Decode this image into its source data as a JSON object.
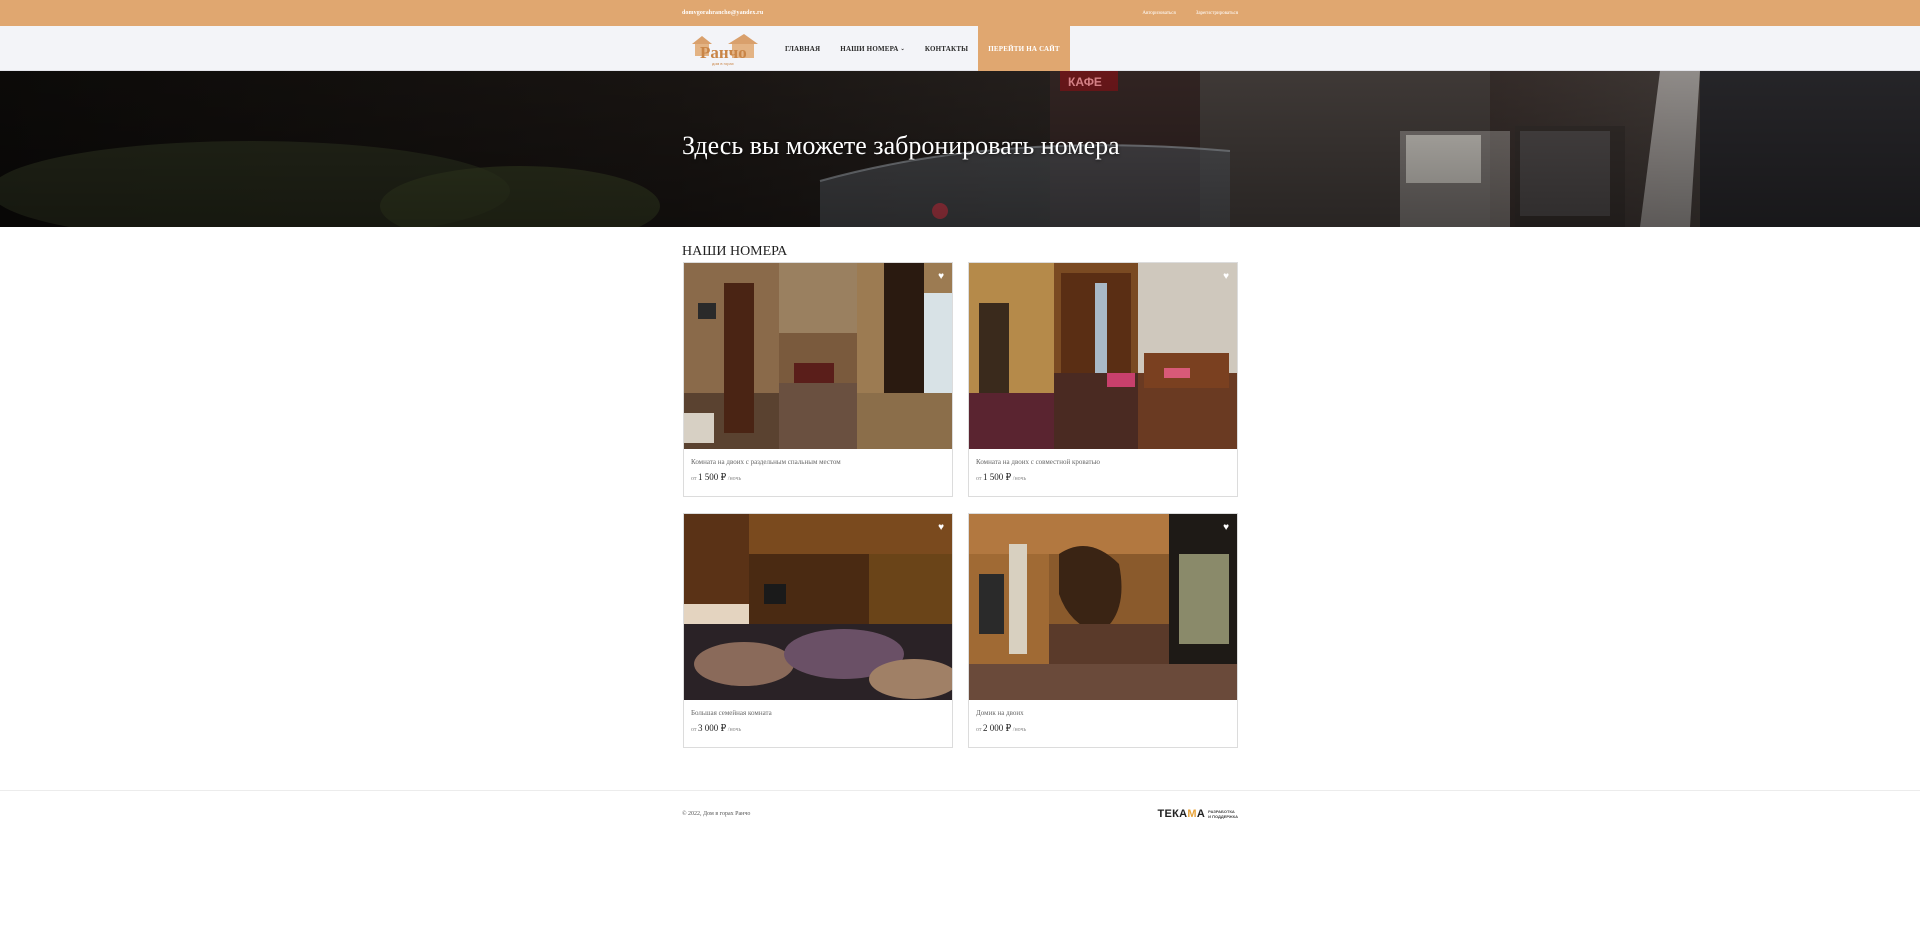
{
  "topbar": {
    "email": "domvgorahrancho@yandex.ru",
    "login": "Авторизоваться",
    "register": "Зарегистрироваться"
  },
  "nav": {
    "logo_text": "Ранчо",
    "logo_sub": "дом в горах",
    "items": [
      {
        "label": "ГЛАВНАЯ"
      },
      {
        "label": "НАШИ НОМЕРА",
        "dropdown": true
      },
      {
        "label": "КОНТАКТЫ"
      }
    ],
    "cta": "ПЕРЕЙТИ НА САЙТ"
  },
  "hero": {
    "title": "Здесь вы можете забронировать номера"
  },
  "rooms": {
    "heading": "НАШИ НОМЕРА",
    "items": [
      {
        "title": "Комната на двоих с раздельным спальным местом",
        "from": "от",
        "price": "1 500 ₽",
        "unit": "/ночь"
      },
      {
        "title": "Комната на двоих с совместной кроватью",
        "from": "от",
        "price": "1 500 ₽",
        "unit": "/ночь"
      },
      {
        "title": "Большая семейная комната",
        "from": "от",
        "price": "3 000 ₽",
        "unit": "/ночь"
      },
      {
        "title": "Домик на двоих",
        "from": "от",
        "price": "2 000 ₽",
        "unit": "/ночь"
      }
    ]
  },
  "footer": {
    "copyright": "© 2022,  Дом в горах Ранчо",
    "brand_main": "ТЕКА",
    "brand_accent": "М",
    "brand_end": "А",
    "brand_tag_line1": "РАЗРАБОТКА",
    "brand_tag_line2": "И ПОДДЕРЖКА"
  },
  "colors": {
    "accent": "#e0a770",
    "nav_bg": "#f3f4f8"
  }
}
